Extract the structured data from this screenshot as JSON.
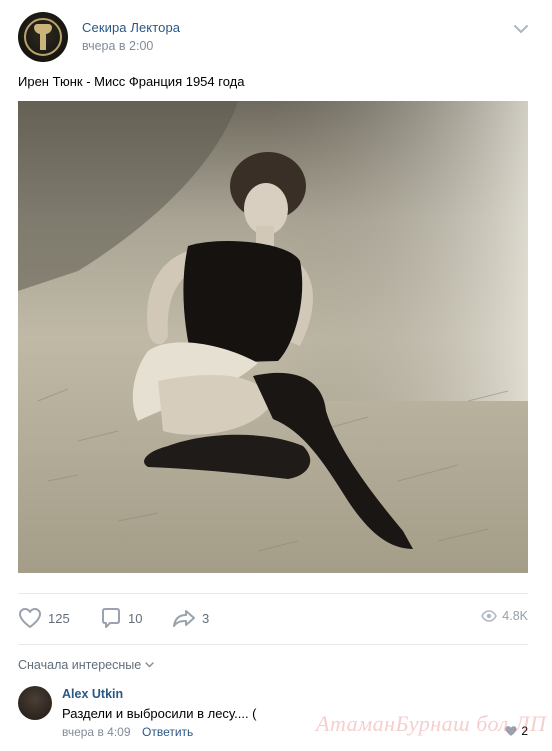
{
  "post": {
    "author": "Секира Лектора",
    "time": "вчера в 2:00",
    "text": "Ирен Тюнк - Мисс Франция 1954 года"
  },
  "actions": {
    "likes": "125",
    "comments": "10",
    "shares": "3",
    "views": "4.8K"
  },
  "comments_section": {
    "sort_label": "Сначала интересные"
  },
  "comment": {
    "author": "Alex Utkin",
    "text": "Раздели и выбросили в лесу.... (",
    "time": "вчера в 4:09",
    "reply_label": "Ответить",
    "likes": "2"
  },
  "watermark": "АтаманБурнаш бол ЛП",
  "colors": {
    "link": "#2a5885",
    "muted": "#818c99",
    "icon": "#99a2ad"
  }
}
